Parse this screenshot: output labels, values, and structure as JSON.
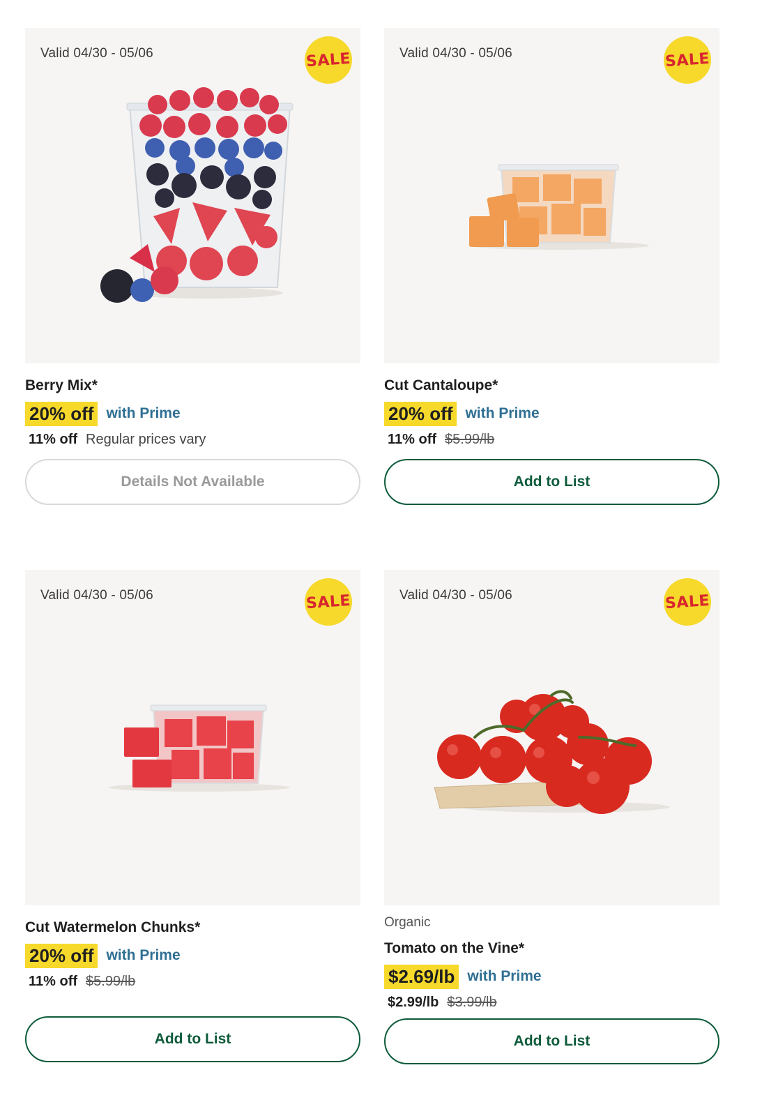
{
  "products": [
    {
      "valid": "Valid 04/30 - 05/06",
      "sale": "SALE",
      "brand": "",
      "name": "Berry Mix*",
      "deal": "20% off",
      "prime": "with Prime",
      "sub_off": "11% off",
      "sub_note": "Regular prices vary",
      "strike": "",
      "button": "Details Not Available",
      "button_enabled": false,
      "image_icon": "berry-mix-cup"
    },
    {
      "valid": "Valid 04/30 - 05/06",
      "sale": "SALE",
      "brand": "",
      "name": "Cut Cantaloupe*",
      "deal": "20% off",
      "prime": "with Prime",
      "sub_off": "11% off",
      "sub_note": "",
      "strike": "$5.99/lb",
      "button": "Add to List",
      "button_enabled": true,
      "image_icon": "cantaloupe-cubes"
    },
    {
      "valid": "Valid 04/30 - 05/06",
      "sale": "SALE",
      "brand": "",
      "name": "Cut Watermelon Chunks*",
      "deal": "20% off",
      "prime": "with Prime",
      "sub_off": "11% off",
      "sub_note": "",
      "strike": "$5.99/lb",
      "button": "Add to List",
      "button_enabled": true,
      "image_icon": "watermelon-cubes"
    },
    {
      "valid": "Valid 04/30 - 05/06",
      "sale": "SALE",
      "brand": "Organic",
      "name": "Tomato on the Vine*",
      "deal": "$2.69/lb",
      "prime": "with Prime",
      "sub_off": "$2.99/lb",
      "sub_note": "",
      "strike": "$3.99/lb",
      "button": "Add to List",
      "button_enabled": true,
      "image_icon": "tomatoes-on-vine"
    }
  ],
  "colors": {
    "deal_highlight": "#f6d92b",
    "sale_text": "#d8262e",
    "prime_text": "#2f6f93",
    "button_green": "#0e5b3b",
    "image_bg": "#f7f5f3"
  }
}
